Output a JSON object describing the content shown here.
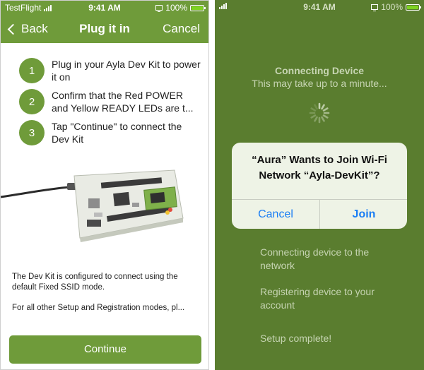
{
  "left": {
    "status_bar": {
      "carrier": "TestFlight",
      "time": "9:41 AM",
      "battery": "100%"
    },
    "nav": {
      "back_label": "Back",
      "title": "Plug it in",
      "cancel_label": "Cancel"
    },
    "steps": [
      {
        "number": "1",
        "text": "Plug in your Ayla Dev Kit to power it on"
      },
      {
        "number": "2",
        "text": "Confirm that the Red POWER and Yellow READY LEDs are t..."
      },
      {
        "number": "3",
        "text": "Tap \"Continue\" to connect the Dev Kit"
      }
    ],
    "info": [
      "The Dev Kit is configured to connect using the default Fixed SSID mode.",
      "For all other Setup and Registration modes, pl..."
    ],
    "continue_label": "Continue"
  },
  "right": {
    "status_bar": {
      "time": "9:41 AM",
      "battery": "100%"
    },
    "connecting_title": "Connecting Device",
    "connecting_subtitle": "This may take up to a minute...",
    "progress": [
      "Connecting device to the network",
      "Registering device to your account",
      "Setup complete!"
    ],
    "alert": {
      "message": "“Aura” Wants to Join Wi-Fi Network “Ayla-DevKit”?",
      "cancel_label": "Cancel",
      "join_label": "Join"
    }
  },
  "colors": {
    "header_green": "#6f9b3a",
    "background_green": "#5a7d2f",
    "ios_blue": "#1a7ef4"
  }
}
